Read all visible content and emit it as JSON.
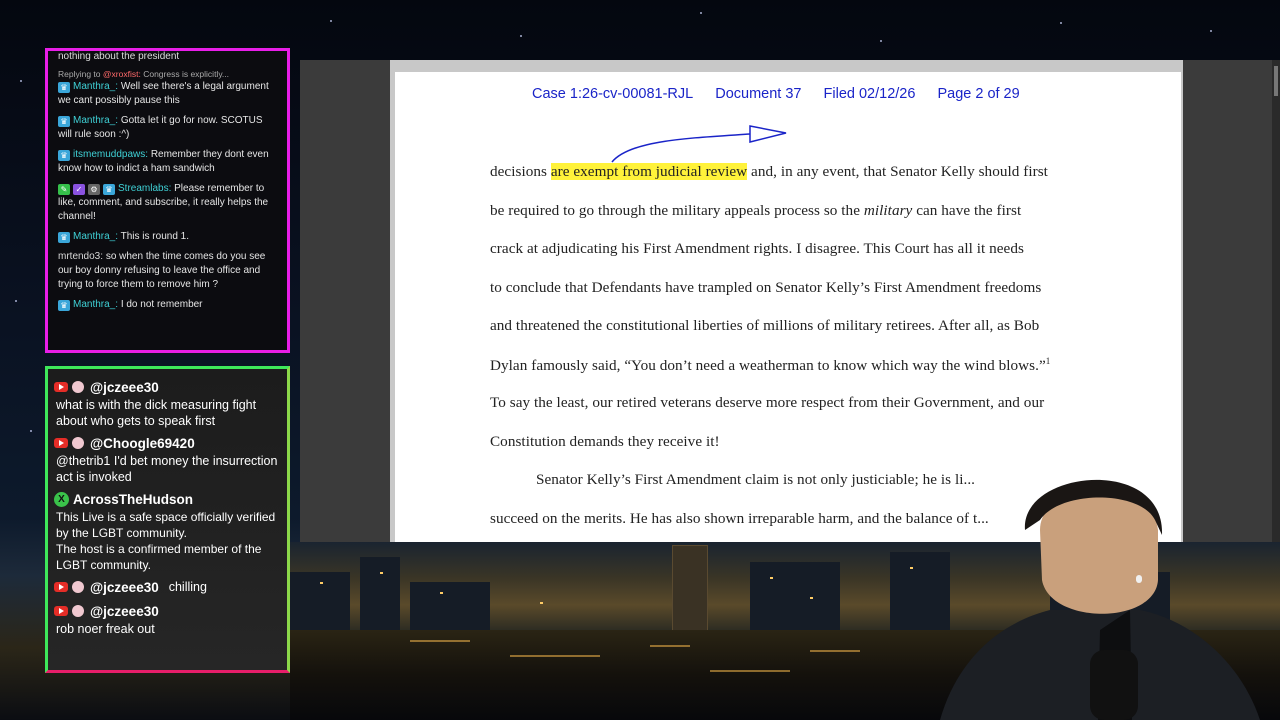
{
  "chat_top": {
    "cutoff_line": "nothing about the president",
    "reply": {
      "prefix": "Replying to",
      "to": "@xroxfist:",
      "text": "Congress is explicitly..."
    },
    "messages": [
      {
        "user": "Manthra_:",
        "text": "Well see there's a legal argument we cant possibly pause this"
      },
      {
        "user": "Manthra_:",
        "text": "Gotta let it go for now. SCOTUS will rule soon :^)"
      },
      {
        "user": "itsmemuddpaws:",
        "text": "Remember they dont even know how to indict a ham sandwich"
      },
      {
        "user": "Streamlabs:",
        "text": "Please remember to like, comment, and subscribe, it really helps the channel!"
      },
      {
        "user": "Manthra_:",
        "text": "This is round 1."
      },
      {
        "user": "mrtendo3:",
        "text": "so when the time comes do you see our boy donny refusing to leave the office and trying to force them to remove him ?"
      },
      {
        "user": "Manthra_:",
        "text": "I do not remember"
      }
    ]
  },
  "chat_bottom": {
    "messages": [
      {
        "user": "@jczeee30",
        "text": "what is with the dick measuring fight about who gets to speak first"
      },
      {
        "user": "@Choogle69420",
        "text": "@thetrib1 I'd bet money the insurrection act is invoked"
      },
      {
        "user": "AcrossTheHudson",
        "lines": [
          "This Live is a safe space officially verified by the LGBT community.",
          "The host is a confirmed member of the LGBT community."
        ]
      },
      {
        "user": "@jczeee30",
        "text": "chilling"
      },
      {
        "user": "@jczeee30",
        "text": "rob noer freak out"
      }
    ]
  },
  "document": {
    "header": [
      "Case 1:26-cv-00081-RJL",
      "Document 37",
      "Filed 02/12/26",
      "Page 2 of 29"
    ],
    "lines": [
      {
        "pre": "decisions ",
        "highlight": "are exempt from judicial review",
        "post": " and, in any event, that Senator Kelly should first"
      },
      {
        "pre": "be required to go through the military appeals process so the ",
        "italic": "military",
        "post": " can have the first"
      },
      {
        "text": "crack at adjudicating his First Amendment rights.  I disagree.  This Court has all it needs"
      },
      {
        "text": "to conclude that Defendants have trampled on Senator Kelly’s First Amendment freedoms"
      },
      {
        "text": "and threatened the constitutional liberties of millions of military retirees.  After all, as Bob"
      },
      {
        "text": "Dylan famously said, “You don’t need a weatherman to know which way the wind blows.”",
        "sup": "1"
      },
      {
        "text": "To say the least, our retired veterans deserve more respect from their Government, and our"
      },
      {
        "text": "Constitution demands they receive it!"
      },
      {
        "text": "Senator Kelly’s First Amendment claim is not only justiciable; he is li..."
      },
      {
        "text": "succeed on the merits.  He has also shown irreparable harm, and the balance of t..."
      }
    ]
  }
}
